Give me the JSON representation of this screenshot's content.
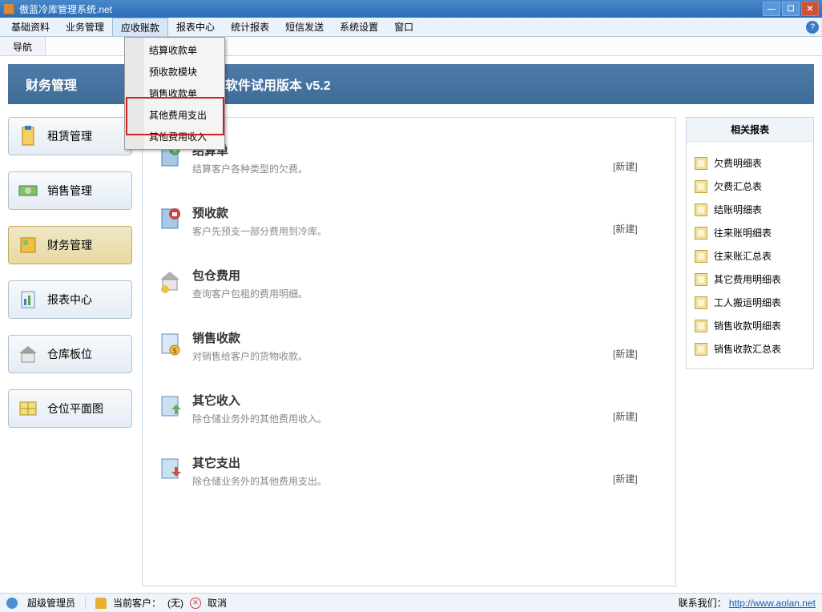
{
  "window": {
    "title": "傲蓝冷库管理系统.net"
  },
  "menubar": {
    "items": [
      "基础资料",
      "业务管理",
      "应收账款",
      "报表中心",
      "统计报表",
      "短信发送",
      "系统设置",
      "窗口"
    ]
  },
  "dropdown": {
    "items": [
      "结算收款单",
      "预收款模块",
      "销售收款单",
      "其他费用支出",
      "其他费用收入"
    ]
  },
  "tab": {
    "label": "导航"
  },
  "banner": {
    "title": "财务管理"
  },
  "version": {
    "text": "软件试用版本 v5.2"
  },
  "nav": {
    "items": [
      {
        "label": "租赁管理",
        "active": false
      },
      {
        "label": "销售管理",
        "active": false
      },
      {
        "label": "财务管理",
        "active": true
      },
      {
        "label": "报表中心",
        "active": false
      },
      {
        "label": "仓库板位",
        "active": false
      },
      {
        "label": "仓位平面图",
        "active": false
      }
    ]
  },
  "modules": {
    "items": [
      {
        "title": "结算单",
        "desc": "结算客户各种类型的欠费。",
        "action": "[新建]"
      },
      {
        "title": "预收款",
        "desc": "客户先预支一部分费用到冷库。",
        "action": "[新建]"
      },
      {
        "title": "包仓费用",
        "desc": "查询客户包租的费用明细。",
        "action": ""
      },
      {
        "title": "销售收款",
        "desc": "对销售给客户的货物收款。",
        "action": "[新建]"
      },
      {
        "title": "其它收入",
        "desc": "除仓储业务外的其他费用收入。",
        "action": "[新建]"
      },
      {
        "title": "其它支出",
        "desc": "除仓储业务外的其他费用支出。",
        "action": "[新建]"
      }
    ]
  },
  "related": {
    "title": "相关报表",
    "items": [
      "欠费明细表",
      "欠费汇总表",
      "结账明细表",
      "往来账明细表",
      "往来账汇总表",
      "其它费用明细表",
      "工人搬运明细表",
      "销售收款明细表",
      "销售收款汇总表"
    ]
  },
  "status": {
    "user": "超级管理员",
    "customer_label": "当前客户：",
    "customer_value": "(无)",
    "cancel": "取消",
    "contact_label": "联系我们：",
    "contact_url": "http://www.aolan.net"
  }
}
